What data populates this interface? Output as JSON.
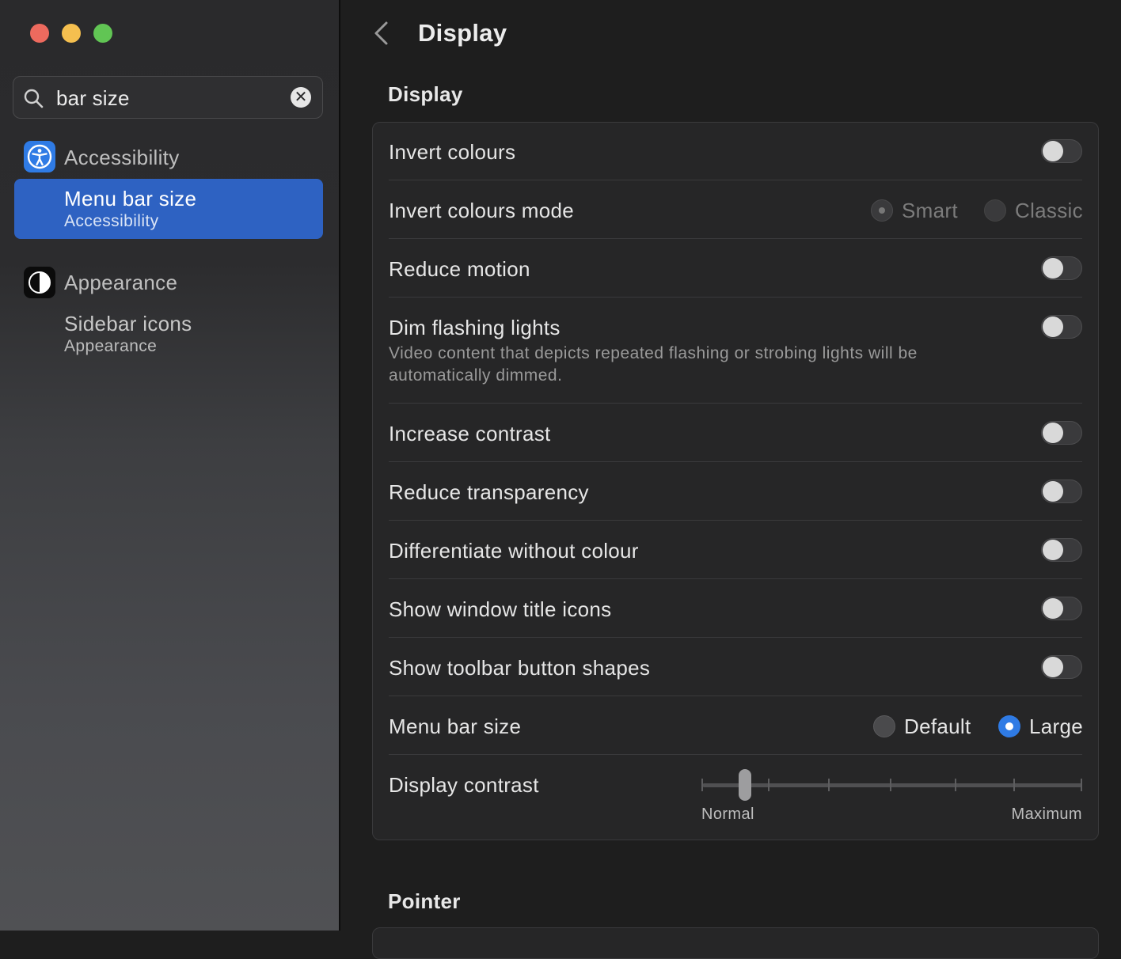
{
  "window": {
    "controls": [
      "close",
      "minimize",
      "zoom"
    ]
  },
  "sidebar": {
    "search": {
      "value": "bar size",
      "placeholder": "Search",
      "icon": "search-icon"
    },
    "groups": [
      {
        "app": "Accessibility",
        "icon": "accessibility-icon",
        "results": [
          {
            "title": "Menu bar size",
            "subtitle": "Accessibility",
            "selected": true
          }
        ]
      },
      {
        "app": "Appearance",
        "icon": "appearance-icon",
        "results": [
          {
            "title": "Sidebar icons",
            "subtitle": "Appearance",
            "selected": false
          }
        ]
      }
    ],
    "selection_color": "#2e62c2"
  },
  "main": {
    "title": "Display",
    "back_icon": "chevron-left-icon",
    "sections": [
      {
        "title": "Display",
        "rows": [
          {
            "label": "Invert colours",
            "control": "toggle",
            "on": false
          },
          {
            "label": "Invert colours mode",
            "control": "radio",
            "options": [
              "Smart",
              "Classic"
            ],
            "selected": "Smart",
            "disabled": true
          },
          {
            "label": "Reduce motion",
            "control": "toggle",
            "on": false
          },
          {
            "label": "Dim flashing lights",
            "description": "Video content that depicts repeated flashing or strobing lights will be automatically dimmed.",
            "control": "toggle",
            "on": false
          },
          {
            "label": "Increase contrast",
            "control": "toggle",
            "on": false
          },
          {
            "label": "Reduce transparency",
            "control": "toggle",
            "on": false
          },
          {
            "label": "Differentiate without colour",
            "control": "toggle",
            "on": false
          },
          {
            "label": "Show window title icons",
            "control": "toggle",
            "on": false
          },
          {
            "label": "Show toolbar button shapes",
            "control": "toggle",
            "on": false
          },
          {
            "label": "Menu bar size",
            "control": "radio",
            "options": [
              "Default",
              "Large"
            ],
            "selected": "Large"
          },
          {
            "label": "Display contrast",
            "control": "slider",
            "min_label": "Normal",
            "max_label": "Maximum",
            "value": 0.1
          }
        ]
      },
      {
        "title": "Pointer",
        "rows": []
      }
    ]
  },
  "colors": {
    "accent": "#2f7be5",
    "background": "#1e1e1e",
    "group_background": "#262627"
  }
}
